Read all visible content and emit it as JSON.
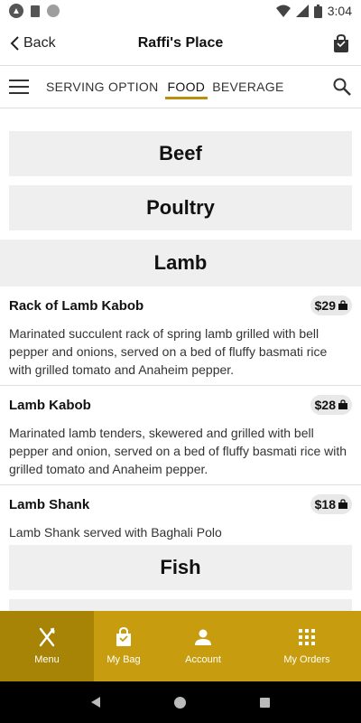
{
  "status_bar": {
    "time": "3:04"
  },
  "app_bar": {
    "back_label": "Back",
    "title": "Raffi's Place"
  },
  "category_nav": {
    "tabs": [
      {
        "label": "SERVING OPTION",
        "active": false
      },
      {
        "label": "FOOD",
        "active": true
      },
      {
        "label": "BEVERAGE",
        "active": false
      }
    ]
  },
  "menu": {
    "sections": [
      "Beef",
      "Poultry",
      "Lamb",
      "Fish"
    ],
    "lamb_items": [
      {
        "name": "Rack of Lamb Kabob",
        "price": "$29",
        "description": "Marinated succulent rack of spring lamb grilled with bell pepper and onions, served on a bed of fluffy basmati rice with grilled tomato and Anaheim pepper."
      },
      {
        "name": "Lamb Kabob",
        "price": "$28",
        "description": "Marinated lamb tenders, skewered and grilled with bell pepper and onion, served on a bed of fluffy basmati rice with grilled tomato and Anaheim pepper."
      },
      {
        "name": "Lamb Shank",
        "price": "$18",
        "description": "Lamb Shank served with Baghali Polo"
      }
    ]
  },
  "bottom_nav": {
    "items": [
      {
        "label": "Menu",
        "icon": "fork-knife-icon",
        "active": true
      },
      {
        "label": "My Bag",
        "icon": "bag-icon",
        "active": false
      },
      {
        "label": "Account",
        "icon": "person-icon",
        "active": false
      },
      {
        "label": "My Orders",
        "icon": "grid-icon",
        "active": false
      }
    ]
  },
  "colors": {
    "accent": "#c79d0f",
    "accent_dark": "#a88406",
    "section_bg": "#efefef"
  }
}
